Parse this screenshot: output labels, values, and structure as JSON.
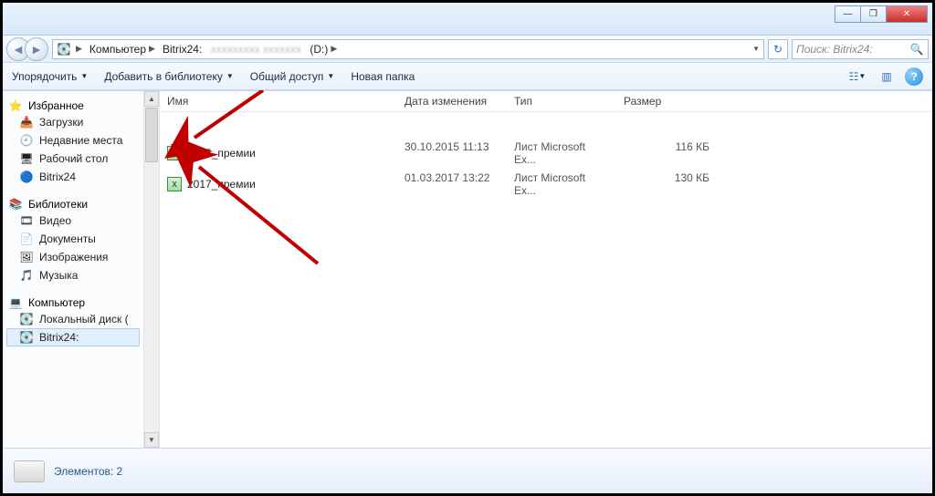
{
  "window": {
    "min": "—",
    "max": "❐",
    "close": "✕"
  },
  "breadcrumb": {
    "computer": "Компьютер",
    "drive": "Bitrix24:",
    "drive_suffix": "(D:)"
  },
  "search_placeholder": "Поиск: Bitrix24:",
  "toolbar": {
    "organize": "Упорядочить",
    "add_library": "Добавить в библиотеку",
    "share": "Общий доступ",
    "new_folder": "Новая папка"
  },
  "columns": {
    "name": "Имя",
    "date": "Дата изменения",
    "type": "Тип",
    "size": "Размер"
  },
  "sidebar": {
    "favorites_head": "Избранное",
    "favorites": [
      {
        "icon": "📥",
        "label": "Загрузки"
      },
      {
        "icon": "🕘",
        "label": "Недавние места"
      },
      {
        "icon": "🖥",
        "label": "Рабочий стол"
      },
      {
        "icon": "🔵",
        "label": "Bitrix24"
      }
    ],
    "libraries_head": "Библиотеки",
    "libraries": [
      {
        "icon": "🎞",
        "label": "Видео"
      },
      {
        "icon": "📄",
        "label": "Документы"
      },
      {
        "icon": "🖼",
        "label": "Изображения"
      },
      {
        "icon": "🎵",
        "label": "Музыка"
      }
    ],
    "computer_head": "Компьютер",
    "computer": [
      {
        "icon": "💽",
        "label": "Локальный диск (",
        "sel": false
      },
      {
        "icon": "💽",
        "label": "Bitrix24:",
        "sel": true
      }
    ]
  },
  "files": [
    {
      "name": "2015_премии",
      "date": "30.10.2015 11:13",
      "type": "Лист Microsoft Ex...",
      "size": "116 КБ"
    },
    {
      "name": "2017_премии",
      "date": "01.03.2017 13:22",
      "type": "Лист Microsoft Ex...",
      "size": "130 КБ"
    }
  ],
  "status_label": "Элементов: 2"
}
